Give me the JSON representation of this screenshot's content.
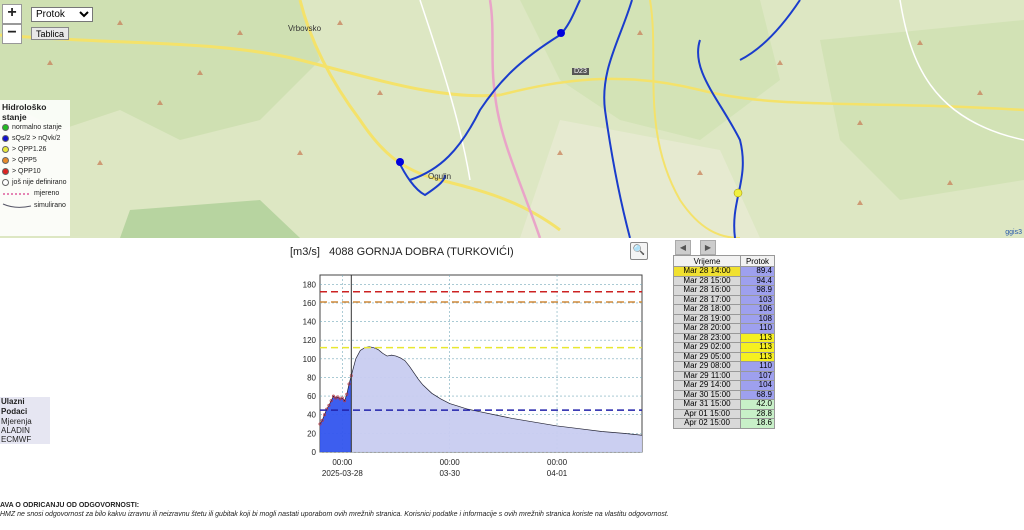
{
  "map": {
    "zoom_in": "+",
    "zoom_out": "−",
    "layer_select_value": "Protok",
    "table_button": "Tablica",
    "place_labels": [
      "Vrbovsko",
      "Ogulin",
      "D23"
    ],
    "credit": "ggis3",
    "legend": {
      "title": "Hidrološko stanje",
      "items": [
        {
          "label": "normalno stanje",
          "color": "#22bb22"
        },
        {
          "label": "sQs/2 > nQvk/2",
          "color": "#1111cc"
        },
        {
          "label": "> QPP1.26",
          "color": "#e8e83a"
        },
        {
          "label": "> QPP5",
          "color": "#e88a2a"
        },
        {
          "label": "> QPP10",
          "color": "#dd2222"
        },
        {
          "label": "još nije definirano",
          "color": "#ffffff"
        }
      ],
      "line_measured": "mjereno",
      "line_simulated": "simulirano"
    },
    "station_colors": {
      "blue": "#0000dd",
      "yellow": "#f0f040"
    }
  },
  "chart": {
    "unit": "[m3/s]",
    "station": "4088 GORNJA DOBRA (TURKOVIĆI)",
    "zoom_icon": "🔍"
  },
  "chart_data": {
    "type": "area",
    "ylim": [
      0,
      190
    ],
    "yticks": [
      0,
      20,
      40,
      60,
      80,
      100,
      120,
      140,
      160,
      180
    ],
    "xticks": [
      {
        "t": 4,
        "label": "00:00",
        "date": "2025-03-28"
      },
      {
        "t": 52,
        "label": "00:00",
        "date": "03-30"
      },
      {
        "t": 100,
        "label": "00:00",
        "date": "04-01"
      }
    ],
    "xrange": [
      -6,
      138
    ],
    "now_t": 8,
    "thresholds": [
      {
        "value": 172,
        "color": "#cc2222"
      },
      {
        "value": 161,
        "color": "#d08a3a"
      },
      {
        "value": 112,
        "color": "#e8e830"
      },
      {
        "value": 45,
        "color": "#2222aa"
      }
    ],
    "series": [
      {
        "name": "mjereno",
        "color": "#3355ee",
        "points": [
          [
            -6,
            30
          ],
          [
            -5,
            34
          ],
          [
            -4,
            40
          ],
          [
            -3,
            46
          ],
          [
            -2,
            50
          ],
          [
            -1,
            55
          ],
          [
            0,
            60
          ],
          [
            1,
            58
          ],
          [
            2,
            59
          ],
          [
            3,
            57
          ],
          [
            4,
            58
          ],
          [
            5,
            55
          ],
          [
            6,
            62
          ],
          [
            7,
            73
          ],
          [
            8,
            82
          ]
        ]
      },
      {
        "name": "simulirano",
        "color": "#c8ccf0",
        "points": [
          [
            8,
            82
          ],
          [
            10,
            100
          ],
          [
            12,
            109
          ],
          [
            14,
            112
          ],
          [
            16,
            113
          ],
          [
            18,
            112
          ],
          [
            20,
            110
          ],
          [
            22,
            106
          ],
          [
            24,
            103
          ],
          [
            26,
            104
          ],
          [
            28,
            103
          ],
          [
            30,
            101
          ],
          [
            32,
            98
          ],
          [
            34,
            92
          ],
          [
            36,
            85
          ],
          [
            38,
            78
          ],
          [
            40,
            72
          ],
          [
            44,
            63
          ],
          [
            48,
            57
          ],
          [
            52,
            52
          ],
          [
            56,
            49
          ],
          [
            60,
            46
          ],
          [
            66,
            43
          ],
          [
            72,
            40
          ],
          [
            80,
            36
          ],
          [
            90,
            32
          ],
          [
            100,
            28
          ],
          [
            110,
            25
          ],
          [
            120,
            22
          ],
          [
            130,
            20
          ],
          [
            138,
            18
          ]
        ]
      }
    ]
  },
  "table": {
    "headers": [
      "Vrijeme",
      "Protok"
    ],
    "rows": [
      {
        "time": "Mar 28 14:00",
        "value": "89.4",
        "hl": "#f0e030",
        "vc": "#9ea0ee"
      },
      {
        "time": "Mar 28 15:00",
        "value": "94.4",
        "hl": "",
        "vc": "#9ea0ee"
      },
      {
        "time": "Mar 28 16:00",
        "value": "98.9",
        "hl": "",
        "vc": "#9ea0ee"
      },
      {
        "time": "Mar 28 17:00",
        "value": "103",
        "hl": "",
        "vc": "#9ea0ee"
      },
      {
        "time": "Mar 28 18:00",
        "value": "106",
        "hl": "",
        "vc": "#9ea0ee"
      },
      {
        "time": "Mar 28 19:00",
        "value": "108",
        "hl": "",
        "vc": "#9ea0ee"
      },
      {
        "time": "Mar 28 20:00",
        "value": "110",
        "hl": "",
        "vc": "#9ea0ee"
      },
      {
        "time": "Mar 28 23:00",
        "value": "113",
        "hl": "",
        "vc": "#f5f020"
      },
      {
        "time": "Mar 29 02:00",
        "value": "113",
        "hl": "",
        "vc": "#f5f020"
      },
      {
        "time": "Mar 29 05:00",
        "value": "113",
        "hl": "",
        "vc": "#f5f020"
      },
      {
        "time": "Mar 29 08:00",
        "value": "110",
        "hl": "",
        "vc": "#9ea0ee"
      },
      {
        "time": "Mar 29 11:00",
        "value": "107",
        "hl": "",
        "vc": "#9ea0ee"
      },
      {
        "time": "Mar 29 14:00",
        "value": "104",
        "hl": "",
        "vc": "#9ea0ee"
      },
      {
        "time": "Mar 30 15:00",
        "value": "68.9",
        "hl": "",
        "vc": "#9ea0ee"
      },
      {
        "time": "Mar 31 15:00",
        "value": "42.0",
        "hl": "",
        "vc": "#c8f0c8"
      },
      {
        "time": "Apr 01 15:00",
        "value": "28.8",
        "hl": "",
        "vc": "#c8f0c8"
      },
      {
        "time": "Apr 02 15:00",
        "value": "18.6",
        "hl": "",
        "vc": "#c8f0c8"
      }
    ]
  },
  "inputs": {
    "title": "Ulazni Podaci",
    "items": [
      "Mjerenja",
      "ALADIN",
      "ECMWF"
    ]
  },
  "disclaimer": {
    "title": "AVA O ODRICANJU OD ODGOVORNOSTI:",
    "body": "HMZ ne snosi odgovornost za bilo kakvu izravnu ili neizravnu štetu ili gubitak koji bi mogli nastati uporabom ovih mrežnih stranica. Korisnici podatke i informacije s ovih mrežnih stranica koriste na vlastitu odgovornost."
  }
}
